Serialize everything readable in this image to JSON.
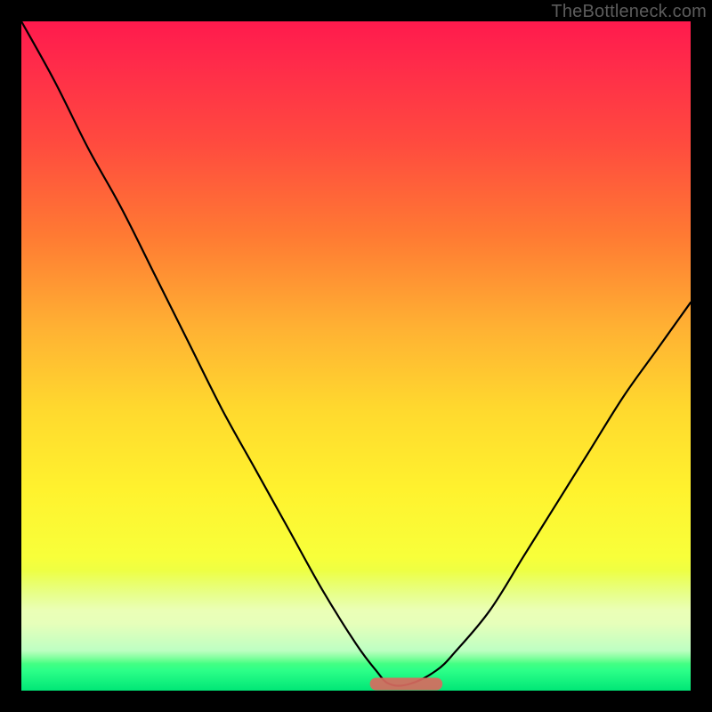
{
  "watermark": {
    "text": "TheBottleneck.com"
  },
  "chart_data": {
    "type": "line",
    "title": "",
    "xlabel": "",
    "ylabel": "",
    "xlim": [
      0,
      100
    ],
    "ylim": [
      0,
      100
    ],
    "grid": false,
    "legend": false,
    "series": [
      {
        "name": "bottleneck-curve",
        "x": [
          0,
          5,
          10,
          15,
          20,
          25,
          30,
          35,
          40,
          45,
          50,
          53,
          55,
          58,
          62,
          65,
          70,
          75,
          80,
          85,
          90,
          95,
          100
        ],
        "values": [
          100,
          91,
          81,
          72,
          62,
          52,
          42,
          33,
          24,
          15,
          7,
          3,
          1,
          1,
          3,
          6,
          12,
          20,
          28,
          36,
          44,
          51,
          58
        ]
      },
      {
        "name": "optimal-flat-region",
        "x": [
          53,
          55,
          57,
          60,
          62
        ],
        "values": [
          1,
          1,
          1,
          1,
          1
        ]
      }
    ],
    "background_gradient_stops": [
      {
        "pos": 0,
        "color": "#ff1a4d"
      },
      {
        "pos": 18,
        "color": "#ff4a3f"
      },
      {
        "pos": 46,
        "color": "#ffb233"
      },
      {
        "pos": 70,
        "color": "#fff22e"
      },
      {
        "pos": 90,
        "color": "#c8ff66"
      },
      {
        "pos": 100,
        "color": "#00e676"
      }
    ]
  }
}
